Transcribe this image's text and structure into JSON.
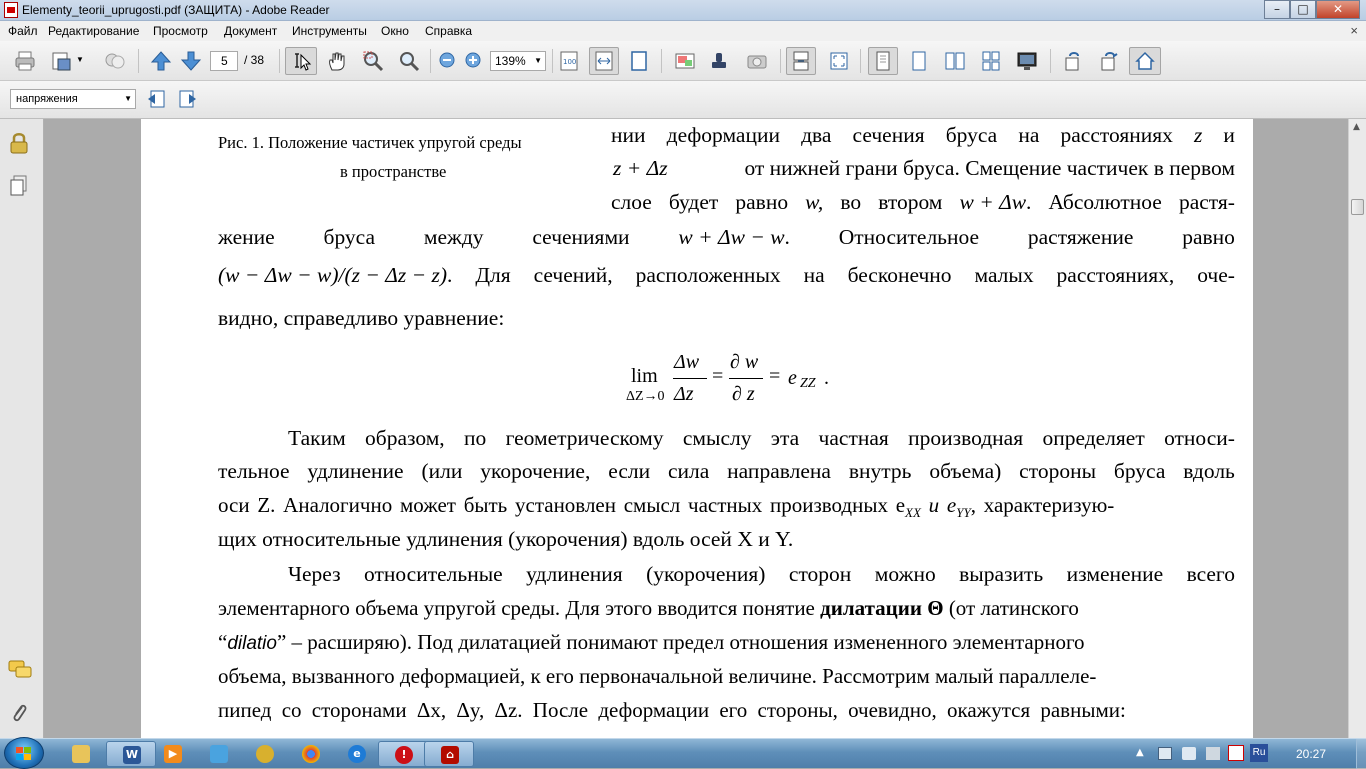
{
  "window": {
    "title": "Elementy_teorii_uprugosti.pdf (ЗАЩИТА) - Adobe Reader",
    "minimize": "–",
    "maximize": "□",
    "close": "✕"
  },
  "menu": {
    "items": [
      "Файл",
      "Редактирование",
      "Просмотр",
      "Документ",
      "Инструменты",
      "Окно",
      "Справка"
    ],
    "close_glyph": "×"
  },
  "toolbar": {
    "page_current": "5",
    "page_total": "/ 38",
    "zoom": "139%"
  },
  "toolbar2": {
    "search_value": "напряжения"
  },
  "document": {
    "caption_line1": "Рис.  1. Положение частичек упругой среды",
    "caption_line2": "в пространстве",
    "p1": [
      [
        "нии",
        "деформации",
        "два",
        "сечения",
        "бруса",
        "на",
        "расстояниях",
        "z",
        "и"
      ],
      [
        "z + Δz",
        "от нижней грани бруса. Смещение частичек в первом"
      ],
      [
        "слое",
        "будет",
        "равно",
        "w,",
        "во",
        "втором",
        "w + Δw",
        ".",
        "Абсолютное",
        "растя-"
      ],
      [
        "жение",
        "бруса",
        "между",
        "сечениями",
        "w + Δw − w",
        ".",
        "Относительное",
        "растяжение",
        "равно"
      ],
      [
        "(w − Δw − w)/(z − Δz − z)",
        ".",
        "Для",
        "сечений,",
        "расположенных",
        "на",
        "бесконечно",
        "малых",
        "расстояниях,",
        "оче-"
      ],
      [
        "видно, справедливо уравнение:"
      ]
    ],
    "formula": {
      "lim": "lim",
      "sub": "ΔZ→0",
      "num1": "Δw",
      "den1": "Δz",
      "eq1": "=",
      "num2": "∂ w",
      "den2": "∂ z",
      "eq2": "=",
      "rhs": "e",
      "rhs_sub": "ZZ",
      "end": "."
    },
    "p2": [
      [
        "Таким",
        "образом,",
        "по",
        "геометрическому",
        "смыслу",
        "эта",
        "частная",
        "производная",
        "определяет",
        "относи-"
      ],
      [
        "тельное",
        "удлинение",
        "(или",
        "укорочение,",
        "если",
        "сила",
        "направлена",
        "внутрь",
        "объема)",
        "стороны",
        "бруса",
        "вдоль"
      ],
      [
        "оси Z. Аналогично может быть установлен смысл частных производных e",
        "XX",
        " и e",
        "YY",
        ", характеризую-"
      ],
      [
        "щих относительные удлинения (укорочения) вдоль осей X и Y."
      ]
    ],
    "p3": [
      [
        "Через",
        "относительные",
        "удлинения",
        "(укорочения)",
        "сторон",
        "можно",
        "выразить",
        "изменение",
        "всего"
      ],
      [
        "элементарного объема упругой среды. Для этого вводится понятие ",
        "дилатации Θ",
        " (от латинского"
      ],
      [
        "“",
        "dilatio",
        "” – расширяю). Под дилатацией понимают предел отношения измененного элементарного"
      ],
      [
        "объема, вызванного деформацией, к его первоначальной величине. Рассмотрим малый параллеле-"
      ],
      [
        "пипед со сторонами Δx, Δy, Δz. После деформации его стороны, очевидно, окажутся равными:"
      ]
    ]
  },
  "taskbar": {
    "clock": "20:27",
    "lang": "Ru"
  }
}
